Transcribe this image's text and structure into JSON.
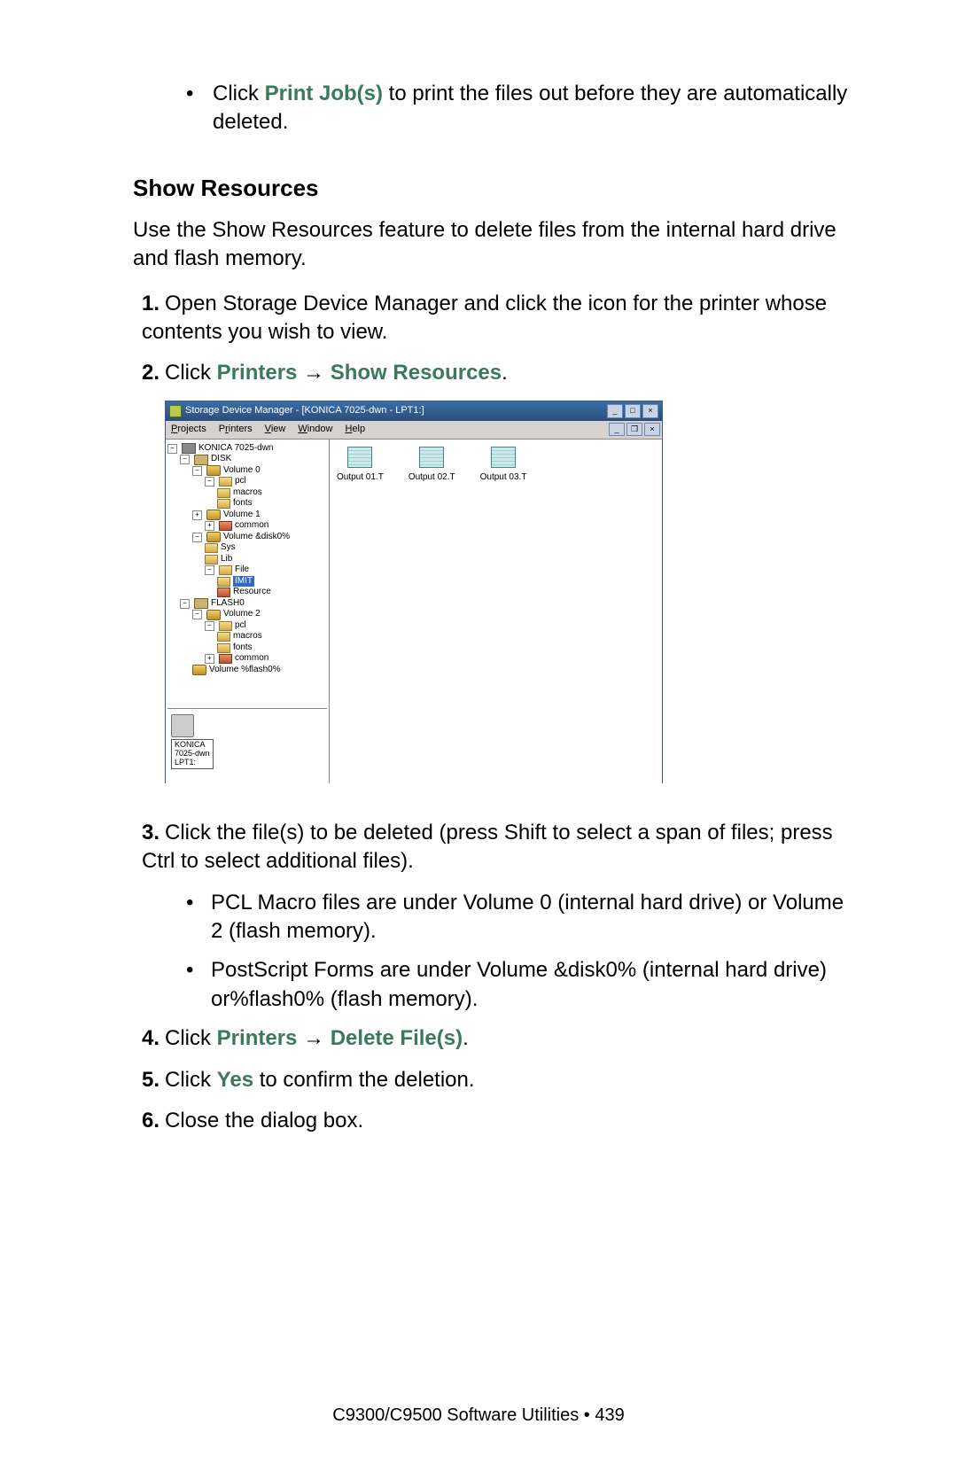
{
  "intro_bullet": {
    "prefix": "Click ",
    "link": "Print Job(s)",
    "suffix": " to print the files out before they are auto­matically deleted."
  },
  "heading": "Show Resources",
  "para1": "Use the Show Resources feature to delete files from the internal hard drive and flash memory.",
  "steps": {
    "s1": {
      "num": "1.",
      "text": "Open Storage Device Manager and click the icon for the printer whose contents you wish to view."
    },
    "s2": {
      "num": "2.",
      "pre": "Click ",
      "l1": "Printers",
      "arrow": " → ",
      "l2": "Show Resources",
      "post": "."
    },
    "s3": {
      "num": "3.",
      "text": "Click the file(s) to be deleted (press Shift to select a span of files; press Ctrl to select additional files)."
    },
    "s3a": "PCL Macro files are under Volume 0 (internal hard drive) or Volume 2 (flash memory).",
    "s3b": "PostScript Forms are under Volume &disk0% (internal hard drive) or%flash0% (flash memory).",
    "s4": {
      "num": "4.",
      "pre": "Click ",
      "l1": "Printers",
      "arrow": " → ",
      "l2": "Delete File(s)",
      "post": "."
    },
    "s5": {
      "num": "5.",
      "pre": "Click ",
      "l1": "Yes",
      "post": " to confirm the deletion."
    },
    "s6": {
      "num": "6.",
      "text": "Close the dialog box."
    }
  },
  "footer": "C9300/C9500 Software Utilities  •  439",
  "window": {
    "title": "Storage Device Manager - [KONICA 7025-dwn - LPT1:]",
    "menus": [
      "Projects",
      "Printers",
      "View",
      "Window",
      "Help"
    ],
    "tree": {
      "root": "KONICA 7025-dwn",
      "disk": "DISK",
      "vol0": "Volume 0",
      "pcl": "pcl",
      "macros": "macros",
      "fonts": "fonts",
      "vol1": "Volume 1",
      "common1": "common",
      "voldisk": "Volume &disk0%",
      "sys": "Sys",
      "lib": "Lib",
      "file": "File",
      "imit": "IMIT",
      "resource": "Resource",
      "flash": "FLASH0",
      "vol2": "Volume 2",
      "pcl2": "pcl",
      "macros2": "macros",
      "fonts2": "fonts",
      "common2": "common",
      "volflash": "Volume %flash0%"
    },
    "thumb": "KONICA\n7025-dwn\nLPT1:",
    "files": [
      "Output 01.T",
      "Output 02.T",
      "Output 03.T"
    ]
  }
}
